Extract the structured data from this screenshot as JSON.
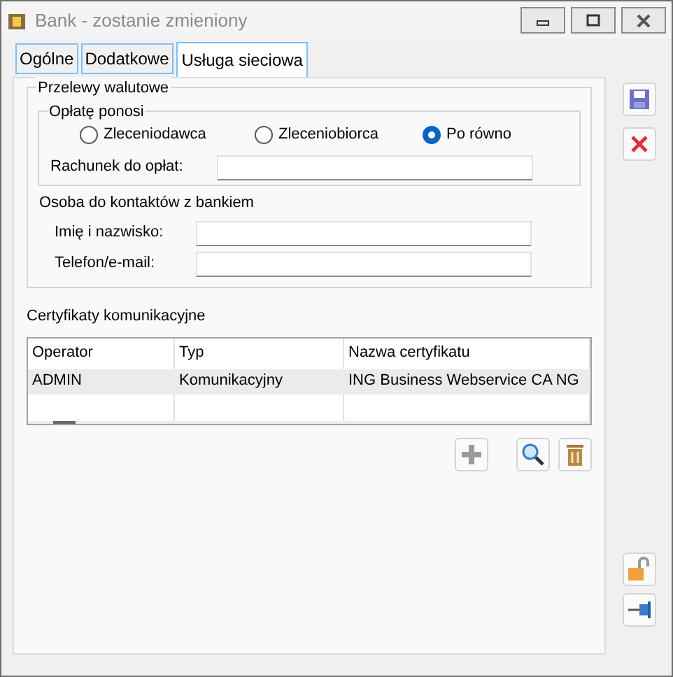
{
  "window": {
    "title": "Bank - zostanie zmieniony"
  },
  "tabs": [
    {
      "label": "Ogólne",
      "selected": false
    },
    {
      "label": "Dodatkowe",
      "selected": false
    },
    {
      "label": "Usługa sieciowa",
      "selected": true
    }
  ],
  "transfers": {
    "title": "Przelewy walutowe",
    "fee_group": {
      "title": "Opłatę ponosi",
      "options": [
        {
          "label": "Zleceniodawca",
          "selected": false
        },
        {
          "label": "Zleceniobiorca",
          "selected": false
        },
        {
          "label": "Po równo",
          "selected": true
        }
      ]
    },
    "account_label": "Rachunek do opłat:",
    "contact_title": "Osoba do kontaktów z bankiem",
    "contact_fields": [
      {
        "label": "Imię i nazwisko:"
      },
      {
        "label": "Telefon/e-mail:"
      }
    ]
  },
  "certificates": {
    "title": "Certyfikaty komunikacyjne",
    "columns": [
      "Operator",
      "Typ",
      "Nazwa certyfikatu"
    ],
    "rows": [
      [
        "ADMIN",
        "Komunikacyjny",
        "ING Business Webservice CA NG"
      ]
    ]
  }
}
